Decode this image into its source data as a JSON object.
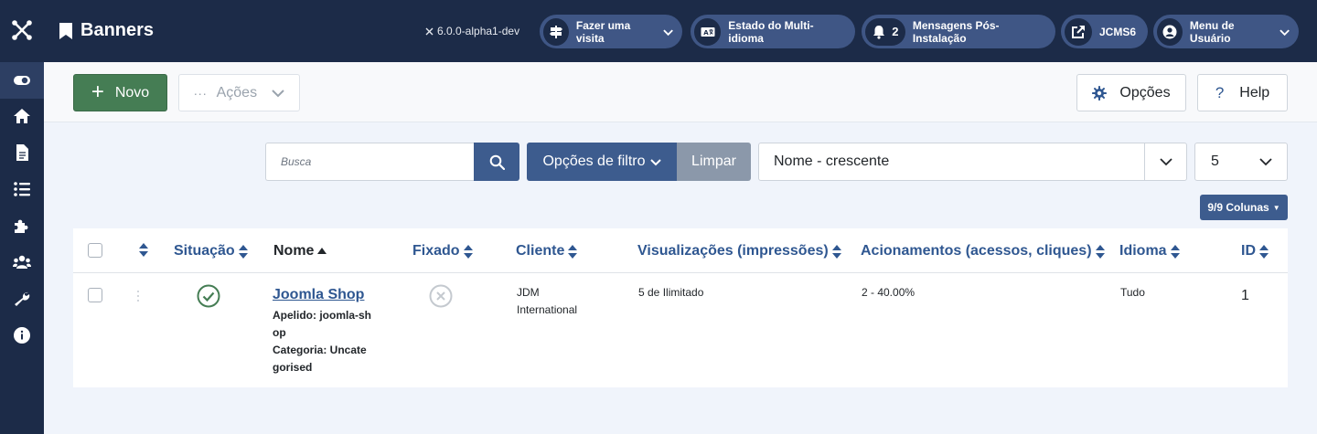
{
  "app": {
    "page_title": "Banners",
    "version": "6.0.0-alpha1-dev",
    "brand_color": "#1c2b48"
  },
  "header": {
    "buttons": [
      {
        "label": "Fazer uma visita",
        "icon": "signpost-icon"
      },
      {
        "label": "Estado do Multi-idioma",
        "icon": "language-icon"
      },
      {
        "label": "Mensagens Pós-Instalação",
        "icon": "bell-icon",
        "count": "2"
      },
      {
        "label": "JCMS6",
        "icon": "external-link-icon"
      },
      {
        "label": "Menu de Usuário",
        "icon": "user-icon"
      }
    ]
  },
  "sidebar": {
    "items": [
      {
        "icon": "toggle-icon",
        "active": true
      },
      {
        "icon": "home-icon"
      },
      {
        "icon": "file-icon"
      },
      {
        "icon": "list-icon"
      },
      {
        "icon": "puzzle-icon"
      },
      {
        "icon": "users-icon"
      },
      {
        "icon": "wrench-icon"
      },
      {
        "icon": "info-icon"
      }
    ]
  },
  "toolbar": {
    "new_label": "Novo",
    "actions_label": "Ações",
    "options_label": "Opções",
    "help_label": "Help"
  },
  "filters": {
    "search_placeholder": "Busca",
    "filter_options_label": "Opções de filtro",
    "clear_label": "Limpar",
    "sort_value": "Nome - crescente",
    "limit_value": "5",
    "columns_label": "9/9 Colunas"
  },
  "table": {
    "columns": {
      "status": "Situação",
      "name": "Nome",
      "pinned": "Fixado",
      "client": "Cliente",
      "impressions": "Visualizações (impressões)",
      "clicks": "Acionamentos (acessos, cliques)",
      "language": "Idioma",
      "id": "ID"
    },
    "rows": [
      {
        "name": "Joomla Shop",
        "alias": "Apelido: joomla-shop",
        "category": "Categoria: Uncategorised",
        "client": "JDM International",
        "impressions": "5 de Ilimitado",
        "clicks": "2 - 40.00%",
        "language": "Tudo",
        "id": "1",
        "published": true,
        "pinned": false
      }
    ]
  }
}
